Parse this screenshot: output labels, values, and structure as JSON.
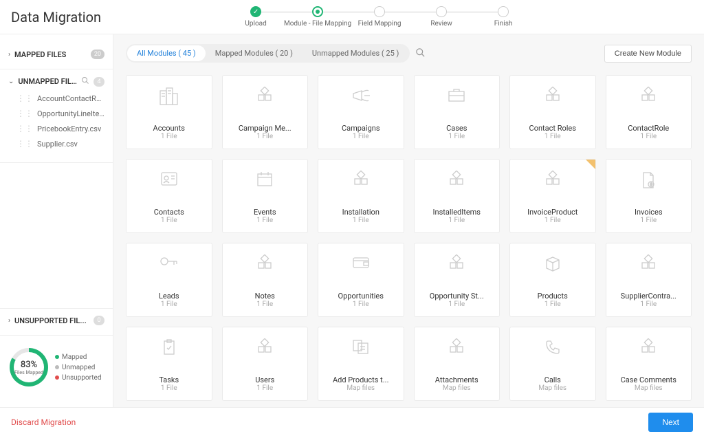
{
  "title": "Data Migration",
  "stepper": {
    "steps": [
      {
        "label": "Upload"
      },
      {
        "label": "Module - File Mapping"
      },
      {
        "label": "Field Mapping"
      },
      {
        "label": "Review"
      },
      {
        "label": "Finish"
      }
    ]
  },
  "sidebar": {
    "mapped": {
      "title": "MAPPED FILES",
      "count": "20"
    },
    "unmapped": {
      "title": "UNMAPPED FILES",
      "count": "4",
      "files": [
        "AccountContactRo...",
        "OpportunityLineIte...",
        "PricebookEntry.csv",
        "Supplier.csv"
      ]
    },
    "unsupported": {
      "title": "UNSUPPORTED FIL...",
      "count": "0"
    },
    "progress": {
      "percent": "83%",
      "label": "Files Mapped",
      "legend": [
        {
          "name": "Mapped",
          "color": "#20b574"
        },
        {
          "name": "Unmapped",
          "color": "#bbbbbb"
        },
        {
          "name": "Unsupported",
          "color": "#e14d4d"
        }
      ]
    }
  },
  "tabs": {
    "all": "All Modules ( 45 )",
    "mapped": "Mapped Modules  ( 20 )",
    "unmapped": "Unmapped Modules  ( 25 )"
  },
  "create_btn": "Create New Module",
  "modules": [
    {
      "title": "Accounts",
      "sub": "1 File",
      "icon": "building"
    },
    {
      "title": "Campaign Me...",
      "sub": "1 File",
      "icon": "squares"
    },
    {
      "title": "Campaigns",
      "sub": "1 File",
      "icon": "megaphone"
    },
    {
      "title": "Cases",
      "sub": "1 File",
      "icon": "briefcase"
    },
    {
      "title": "Contact Roles",
      "sub": "1 File",
      "icon": "squares"
    },
    {
      "title": "ContactRole",
      "sub": "1 File",
      "icon": "squares"
    },
    {
      "title": "Contacts",
      "sub": "1 File",
      "icon": "contact"
    },
    {
      "title": "Events",
      "sub": "1 File",
      "icon": "calendar"
    },
    {
      "title": "Installation",
      "sub": "1 File",
      "icon": "squares"
    },
    {
      "title": "InstalledItems",
      "sub": "1 File",
      "icon": "squares"
    },
    {
      "title": "InvoiceProduct",
      "sub": "1 File",
      "icon": "squares",
      "flag": true
    },
    {
      "title": "Invoices",
      "sub": "1 File",
      "icon": "invoice"
    },
    {
      "title": "Leads",
      "sub": "1 File",
      "icon": "key"
    },
    {
      "title": "Notes",
      "sub": "1 File",
      "icon": "squares"
    },
    {
      "title": "Opportunities",
      "sub": "1 File",
      "icon": "wallet"
    },
    {
      "title": "Opportunity St...",
      "sub": "1 File",
      "icon": "squares"
    },
    {
      "title": "Products",
      "sub": "1 File",
      "icon": "box"
    },
    {
      "title": "SupplierContra...",
      "sub": "1 File",
      "icon": "squares"
    },
    {
      "title": "Tasks",
      "sub": "1 File",
      "icon": "task"
    },
    {
      "title": "Users",
      "sub": "1 File",
      "icon": "squares"
    },
    {
      "title": "Add Products t...",
      "sub": "Map files",
      "icon": "files"
    },
    {
      "title": "Attachments",
      "sub": "Map files",
      "icon": "squares"
    },
    {
      "title": "Calls",
      "sub": "Map files",
      "icon": "phone"
    },
    {
      "title": "Case Comments",
      "sub": "Map files",
      "icon": "squares"
    }
  ],
  "footer": {
    "discard": "Discard Migration",
    "next": "Next"
  },
  "colors": {
    "accent": "#20b574",
    "primary_btn": "#1f8ded",
    "danger": "#e14d4d"
  }
}
